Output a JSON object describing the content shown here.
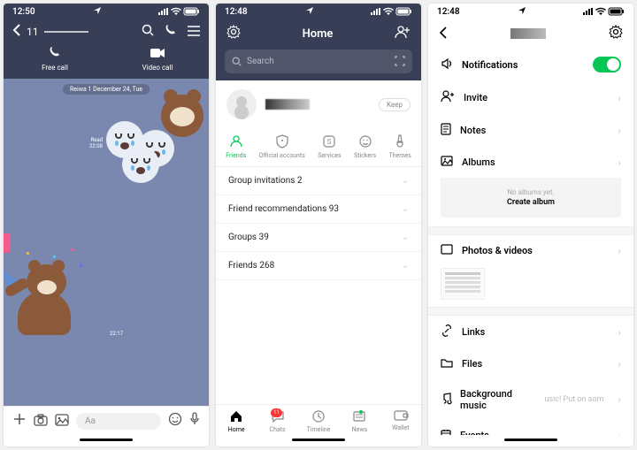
{
  "screen1": {
    "status_time": "12:50",
    "back_count": "11",
    "free_call": "Free call",
    "video_call": "Video call",
    "date_chip": "Reiwa 1 December 24, Tue",
    "read_label": "Read",
    "read_time": "22:08",
    "msg_time": "22:17",
    "input_placeholder": "Aa"
  },
  "screen2": {
    "status_time": "12:48",
    "title": "Home",
    "search_placeholder": "Search",
    "keep_label": "Keep",
    "categories": [
      {
        "label": "Friends"
      },
      {
        "label": "Official accounts"
      },
      {
        "label": "Services"
      },
      {
        "label": "Stickers"
      },
      {
        "label": "Themes"
      }
    ],
    "rows": [
      {
        "label": "Group invitations 2"
      },
      {
        "label": "Friend recommendations 93"
      },
      {
        "label": "Groups 39"
      },
      {
        "label": "Friends 268"
      }
    ],
    "nav": [
      {
        "label": "Home"
      },
      {
        "label": "Chats",
        "badge": "11"
      },
      {
        "label": "Timeline"
      },
      {
        "label": "News",
        "dot": true
      },
      {
        "label": "Wallet"
      }
    ]
  },
  "screen3": {
    "status_time": "12:48",
    "rows": {
      "notifications": "Notifications",
      "invite": "Invite",
      "notes": "Notes",
      "albums": "Albums",
      "photos": "Photos & videos",
      "links": "Links",
      "files": "Files",
      "bgm": "Background music",
      "bgm_hint": "usic!   Put on som",
      "events": "Events"
    },
    "album_empty": "No albums yet.",
    "album_cta": "Create album"
  }
}
